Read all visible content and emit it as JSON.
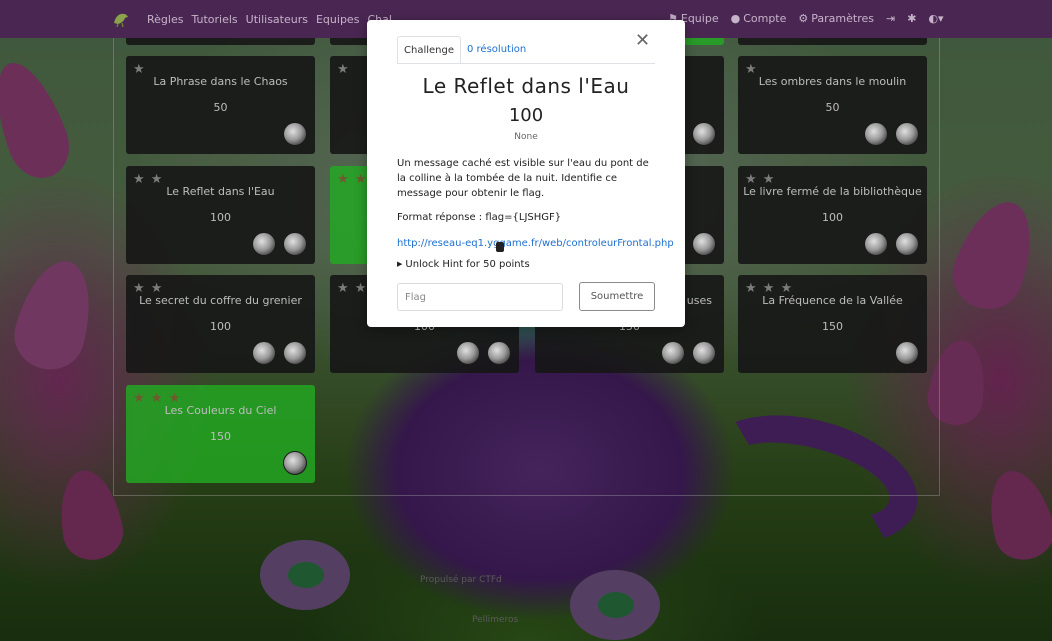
{
  "navbar": {
    "logo_icon": "dragon-logo-icon",
    "left_items": [
      "Règles",
      "Tutoriels",
      "Utilisateurs",
      "Equipes",
      "Chal"
    ],
    "right_items": [
      {
        "icon": "team-icon",
        "label": "Equipe"
      },
      {
        "icon": "user-icon",
        "label": "Compte"
      },
      {
        "icon": "gear-icon",
        "label": "Paramètres"
      }
    ],
    "extra_icons": [
      "logout-icon",
      "settings-icon",
      "theme-icon"
    ]
  },
  "cards": [
    {
      "title": "La Phrase dans le Chaos",
      "points": "50",
      "stars": "★",
      "solved": false
    },
    {
      "title": "Les ombres dans le moulin",
      "points": "50",
      "stars": "★",
      "solved": false
    },
    {
      "title": "Le Reflet dans l'Eau",
      "points": "100",
      "stars": "★ ★",
      "solved": false
    },
    {
      "title": "Le livre fermé de la bibliothèque",
      "points": "100",
      "stars": "★ ★",
      "solved": false
    },
    {
      "title": "Le secret du coffre du grenier",
      "points": "100",
      "stars": "★ ★",
      "solved": false
    },
    {
      "title": "La Fréquence de la Vallée",
      "points": "150",
      "stars": "★ ★ ★",
      "solved": false
    },
    {
      "title": "Les Couleurs du Ciel",
      "points": "150",
      "stars": "★ ★ ★",
      "solved": true
    }
  ],
  "partial_cards": [
    {
      "stars": "★"
    },
    {
      "stars": "★ ★",
      "solved": true
    },
    {
      "stars": "★ ★",
      "points": "100"
    },
    {
      "stars": "",
      "title_fragment": "uses",
      "points": "150"
    }
  ],
  "modal": {
    "tabs": [
      "Challenge",
      "0 résolution"
    ],
    "close_icon": "close-icon",
    "title": "Le Reflet dans l'Eau",
    "points": "100",
    "tags": "None",
    "description": "Un message caché est visible sur l'eau du pont de la colline à la tombée de la nuit. Identifie ce message pour obtenir le flag.",
    "format": "Format réponse : flag={LJSHGF}",
    "link": "http://reseau-eq1.yggame.fr/web/controleurFrontal.php",
    "hint": "Unlock Hint for 50 points",
    "flag_placeholder": "Flag",
    "submit_label": "Soumettre"
  },
  "footer": {
    "line1": "Propulsé par CTFd",
    "line2": "Pellimeros"
  }
}
